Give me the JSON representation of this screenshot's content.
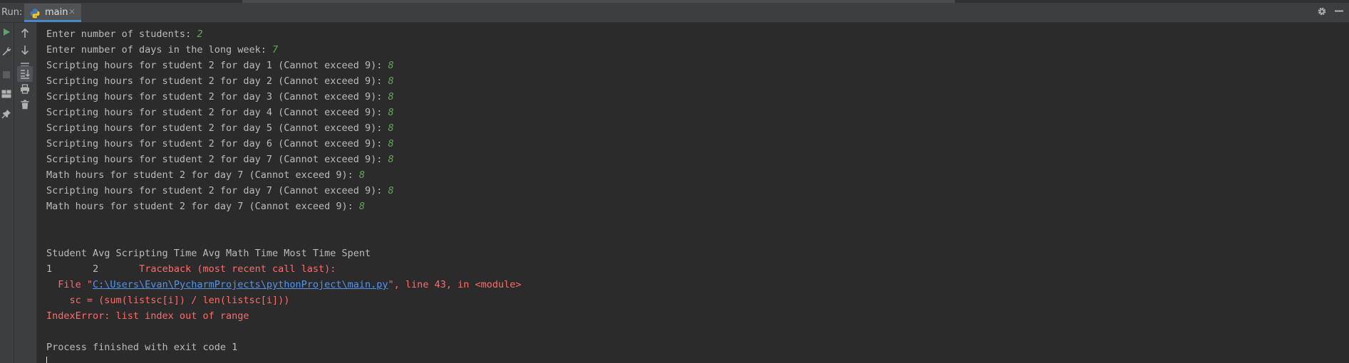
{
  "run_panel": {
    "label": "Run:",
    "tab": {
      "title": "main",
      "close": "×"
    },
    "icons": [
      "settings-gear-icon",
      "minimize-icon"
    ]
  },
  "toolbar_left": {
    "icons": [
      "rerun-icon",
      "wrench-icon",
      "stop-icon",
      "layout-icon",
      "pin-icon"
    ]
  },
  "toolbar_console": {
    "icons": [
      "scroll-up-icon",
      "scroll-down-icon",
      "soft-wrap-icon",
      "scroll-to-end-icon",
      "print-icon",
      "trash-icon"
    ]
  },
  "console": {
    "lines": [
      {
        "text": "Enter number of students: ",
        "input": "2"
      },
      {
        "text": "Enter number of days in the long week: ",
        "input": "7"
      },
      {
        "text": "Scripting hours for student 2 for day 1 (Cannot exceed 9): ",
        "input": "8"
      },
      {
        "text": "Scripting hours for student 2 for day 2 (Cannot exceed 9): ",
        "input": "8"
      },
      {
        "text": "Scripting hours for student 2 for day 3 (Cannot exceed 9): ",
        "input": "8"
      },
      {
        "text": "Scripting hours for student 2 for day 4 (Cannot exceed 9): ",
        "input": "8"
      },
      {
        "text": "Scripting hours for student 2 for day 5 (Cannot exceed 9): ",
        "input": "8"
      },
      {
        "text": "Scripting hours for student 2 for day 6 (Cannot exceed 9): ",
        "input": "8"
      },
      {
        "text": "Scripting hours for student 2 for day 7 (Cannot exceed 9): ",
        "input": "8"
      },
      {
        "text": "Math hours for student 2 for day 7 (Cannot exceed 9): ",
        "input": "8"
      },
      {
        "text": "Scripting hours for student 2 for day 7 (Cannot exceed 9): ",
        "input": "8"
      },
      {
        "text": "Math hours for student 2 for day 7 (Cannot exceed 9): ",
        "input": "8"
      }
    ],
    "table_header": "Student Avg Scripting Time Avg Math Time Most Time Spent",
    "table_row": {
      "student": "1",
      "scripting": "2",
      "traceback": "Traceback (most recent call last):"
    },
    "file_line": {
      "prefix": "  File \"",
      "path": "C:\\Users\\Evan\\PycharmProjects\\pythonProject\\main.py",
      "suffix": "\", line 43, in <module>"
    },
    "code_line": "    sc = (sum(listsc[i]) / len(listsc[i]))",
    "error_line": "IndexError: list index out of range",
    "exit_line": "Process finished with exit code 1"
  },
  "colors": {
    "background": "#2b2b2b",
    "text": "#bbbbbb",
    "input": "#62a855",
    "error": "#ff6b68",
    "link": "#5394ec"
  }
}
